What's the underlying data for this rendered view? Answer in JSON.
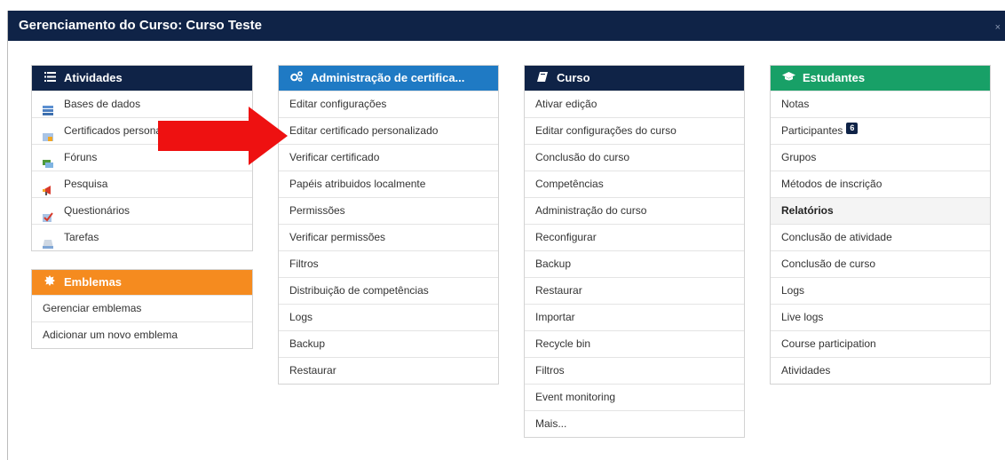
{
  "modal": {
    "title": "Gerenciamento do Curso: Curso Teste",
    "close": "×"
  },
  "panels": {
    "atividades": {
      "title": "Atividades",
      "icon": "list-icon",
      "items": [
        {
          "label": "Bases de dados",
          "icon": "database-icon"
        },
        {
          "label": "Certificados personalizados",
          "icon": "certificate-icon"
        },
        {
          "label": "Fóruns",
          "icon": "forum-icon"
        },
        {
          "label": "Pesquisa",
          "icon": "megaphone-icon"
        },
        {
          "label": "Questionários",
          "icon": "quiz-check-icon"
        },
        {
          "label": "Tarefas",
          "icon": "assignment-icon"
        }
      ]
    },
    "emblemas": {
      "title": "Emblemas",
      "icon": "badge-icon",
      "items": [
        "Gerenciar emblemas",
        "Adicionar um novo emblema"
      ]
    },
    "certificado": {
      "title": "Administração de certifica...",
      "icon": "cogs-icon",
      "items": [
        "Editar configurações",
        "Editar certificado personalizado",
        "Verificar certificado",
        "Papéis atribuidos localmente",
        "Permissões",
        "Verificar permissões",
        "Filtros",
        "Distribuição de competências",
        "Logs",
        "Backup",
        "Restaurar"
      ]
    },
    "curso": {
      "title": "Curso",
      "icon": "book-icon",
      "items": [
        "Ativar edição",
        "Editar configurações do curso",
        "Conclusão do curso",
        "Competências",
        "Administração do curso",
        "Reconfigurar",
        "Backup",
        "Restaurar",
        "Importar",
        "Recycle bin",
        "Filtros",
        "Event monitoring",
        "Mais..."
      ]
    },
    "estudantes": {
      "title": "Estudantes",
      "icon": "graduation-cap-icon",
      "items": {
        "notas": "Notas",
        "participantes": "Participantes",
        "participantes_badge": "6",
        "grupos": "Grupos",
        "metodos": "Métodos de inscrição",
        "relatorios": "Relatórios",
        "conclusao_atividade": "Conclusão de atividade",
        "conclusao_curso": "Conclusão de curso",
        "logs": "Logs",
        "live_logs": "Live logs",
        "course_participation": "Course participation",
        "atividades": "Atividades"
      }
    }
  },
  "colors": {
    "navy": "#0f2347",
    "blue": "#1f7ac4",
    "orange": "#f58b1f",
    "green": "#18a067",
    "arrow": "#ee1111"
  }
}
